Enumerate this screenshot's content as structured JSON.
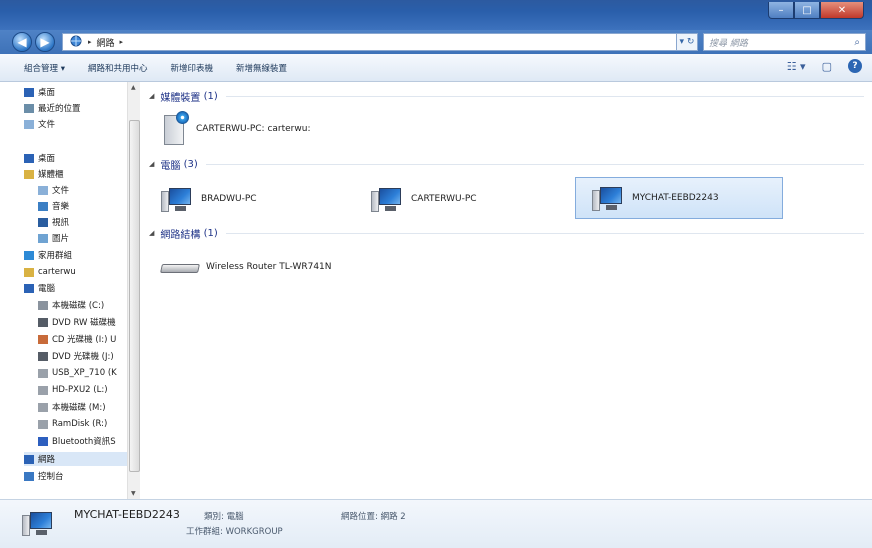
{
  "window": {
    "minimize": "–",
    "maximize": "□",
    "close": "✕"
  },
  "address": {
    "icon": "network-icon",
    "path": [
      "網路"
    ],
    "search_placeholder": "搜尋 網路"
  },
  "toolbar": {
    "items": [
      "組合管理 ▾",
      "網路和共用中心",
      "新增印表機",
      "新增無線裝置"
    ]
  },
  "sidebar": {
    "items": [
      {
        "label": "桌面",
        "icon": "desktop-icon",
        "indent": false,
        "color": "#2b62b5"
      },
      {
        "label": "最近的位置",
        "icon": "recent-places-icon",
        "indent": false,
        "color": "#6b8ea8"
      },
      {
        "label": "文件",
        "icon": "documents-icon",
        "indent": false,
        "color": "#8ab0d8"
      },
      {
        "label": "桌面",
        "icon": "desktop-icon",
        "indent": false,
        "color": "#2b62b5"
      },
      {
        "label": "媒體櫃",
        "icon": "libraries-icon",
        "indent": false,
        "color": "#d9b243"
      },
      {
        "label": "文件",
        "icon": "documents-icon",
        "indent": true,
        "color": "#8ab0d8"
      },
      {
        "label": "音樂",
        "icon": "music-icon",
        "indent": true,
        "color": "#3b7fc4"
      },
      {
        "label": "視訊",
        "icon": "videos-icon",
        "indent": true,
        "color": "#2a5d9f"
      },
      {
        "label": "圖片",
        "icon": "pictures-icon",
        "indent": true,
        "color": "#6fa3d2"
      },
      {
        "label": "家用群組",
        "icon": "homegroup-icon",
        "indent": false,
        "color": "#2d8ad6"
      },
      {
        "label": "carterwu",
        "icon": "user-folder-icon",
        "indent": false,
        "color": "#d9b243"
      },
      {
        "label": "電腦",
        "icon": "computer-icon",
        "indent": false,
        "color": "#2b62b5"
      },
      {
        "label": "本機磁碟 (C:)",
        "icon": "local-disk-icon",
        "indent": true,
        "color": "#8a939e"
      },
      {
        "label": "DVD RW 磁碟機",
        "icon": "dvd-drive-icon",
        "indent": true,
        "color": "#555c66"
      },
      {
        "label": "CD 光碟機 (I:) U",
        "icon": "cd-drive-icon",
        "indent": true,
        "color": "#c86b3a"
      },
      {
        "label": "DVD 光碟機 (J:)",
        "icon": "dvd-drive-icon",
        "indent": true,
        "color": "#555c66"
      },
      {
        "label": "USB_XP_710 (K",
        "icon": "usb-drive-icon",
        "indent": true,
        "color": "#9aa1aa"
      },
      {
        "label": "HD-PXU2 (L:)",
        "icon": "usb-drive-icon",
        "indent": true,
        "color": "#9aa1aa"
      },
      {
        "label": "本機磁碟 (M:)",
        "icon": "usb-drive-icon",
        "indent": true,
        "color": "#9aa1aa"
      },
      {
        "label": "RamDisk (R:)",
        "icon": "usb-drive-icon",
        "indent": true,
        "color": "#9aa1aa"
      },
      {
        "label": "Bluetooth資訊S",
        "icon": "bluetooth-icon",
        "indent": true,
        "color": "#2d5fbf"
      },
      {
        "label": "網路",
        "icon": "network-icon",
        "indent": false,
        "color": "#2b62b5",
        "selected": true
      },
      {
        "label": "控制台",
        "icon": "control-panel-icon",
        "indent": false,
        "color": "#3a78c2"
      }
    ]
  },
  "groups": [
    {
      "title": "媒體裝置",
      "count": "(1)"
    },
    {
      "title": "電腦",
      "count": "(3)"
    },
    {
      "title": "網路結構",
      "count": "(1)"
    }
  ],
  "items": {
    "media": {
      "label": "CARTERWU-PC: carterwu:"
    },
    "computers": [
      {
        "label": "BRADWU-PC"
      },
      {
        "label": "CARTERWU-PC"
      },
      {
        "label": "MYCHAT-EEBD2243"
      }
    ],
    "router": {
      "label": "Wireless Router TL-WR741N"
    }
  },
  "details": {
    "name": "MYCHAT-EEBD2243",
    "category": "類別: 電腦",
    "workgroup": "工作群組: WORKGROUP",
    "location": "網路位置: 網路 2"
  }
}
